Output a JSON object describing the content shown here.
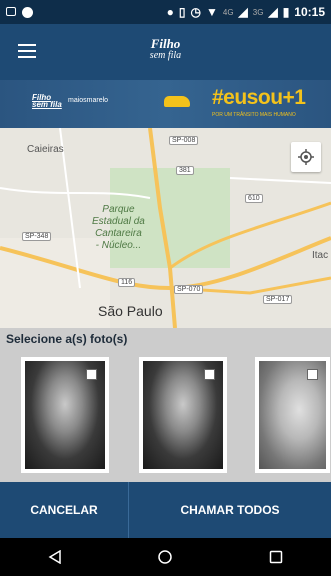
{
  "status_bar": {
    "network_labels": [
      "4G",
      "3G"
    ],
    "time": "10:15"
  },
  "app_bar": {
    "brand_line1": "Filho",
    "brand_line2": "sem fila"
  },
  "banner": {
    "brand_line1": "Filho",
    "brand_line2": "sem fila",
    "partner": "maiosmarelo",
    "hashtag": "#eusou+1",
    "tagline": "POR UM TRÂNSITO MAIS HUMANO"
  },
  "map": {
    "labels": {
      "caieiras": "Caieiras",
      "park_line1": "Parque",
      "park_line2": "Estadual da",
      "park_line3": "Cantareira",
      "park_line4": "- Núcleo...",
      "city": "São Paulo",
      "ita": "Itac"
    },
    "shields": [
      "SP-008",
      "381",
      "610",
      "SP-348",
      "116",
      "SP-070",
      "SP-017"
    ]
  },
  "selection": {
    "title": "Selecione a(s) foto(s)"
  },
  "actions": {
    "cancel": "CANCELAR",
    "call_all": "CHAMAR TODOS"
  },
  "colors": {
    "primary": "#1e4a74",
    "status_bar": "#0e2d4a",
    "accent_yellow": "#f3c21b"
  }
}
